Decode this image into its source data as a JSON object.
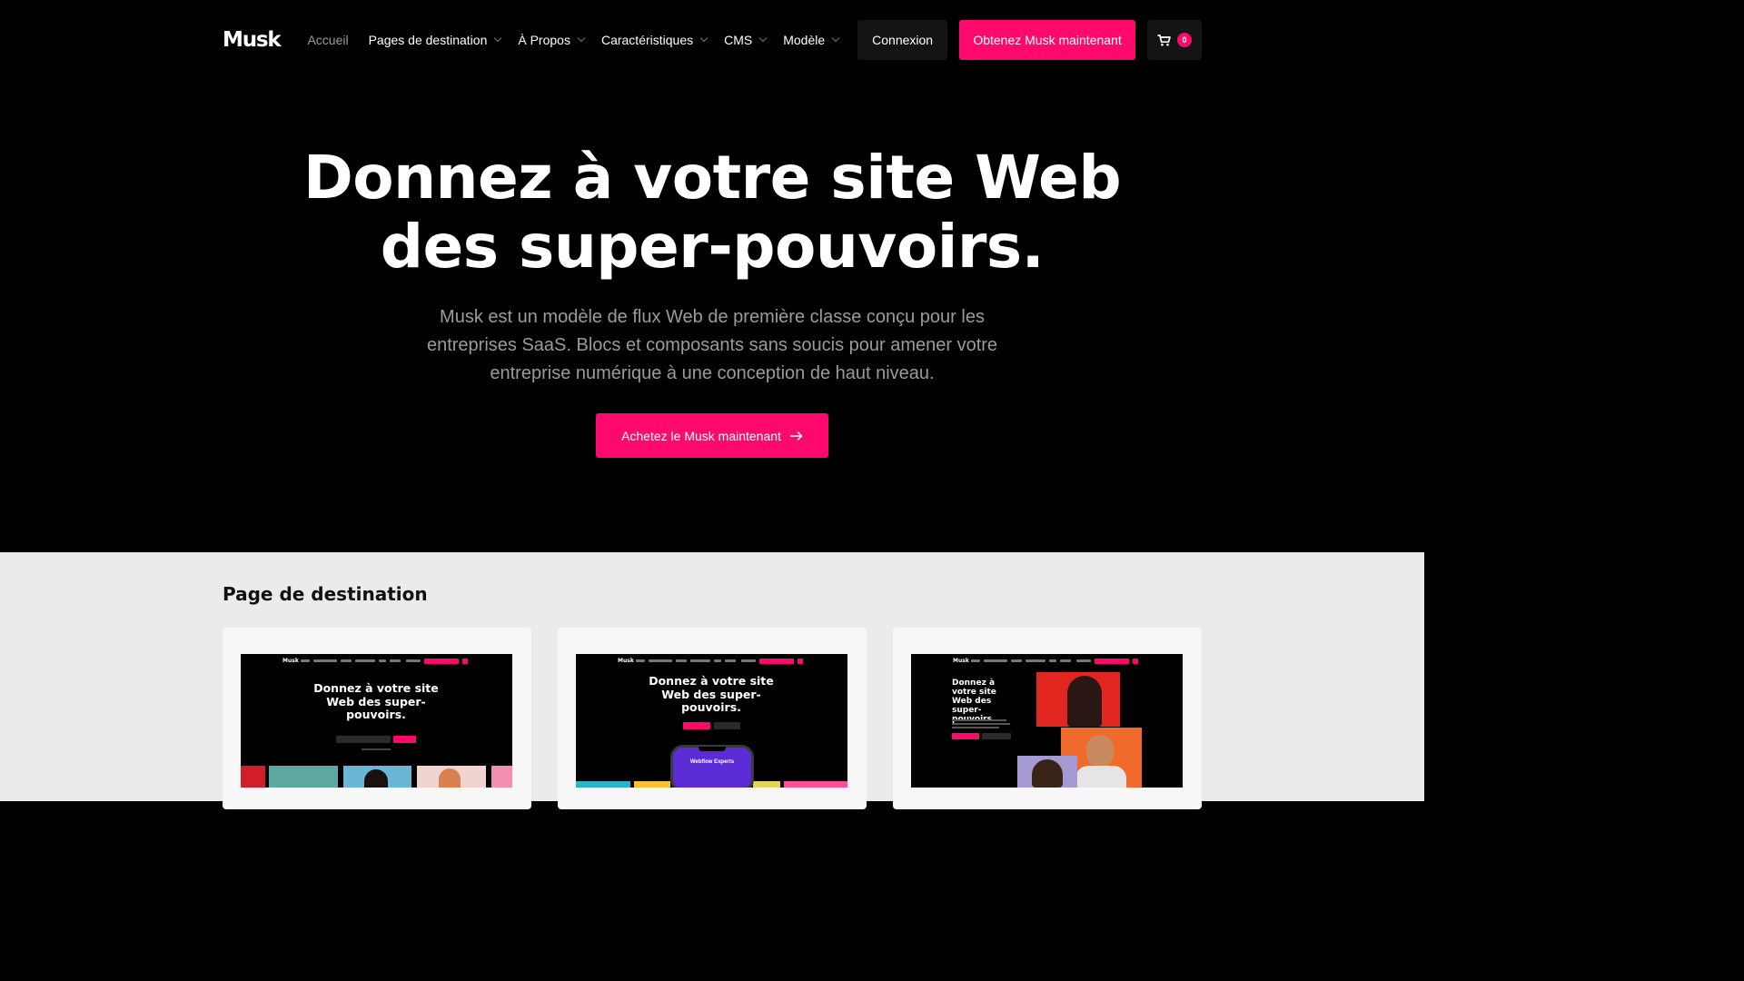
{
  "brand": {
    "logo": "Musk",
    "accent": "#ff0a6c"
  },
  "nav": {
    "items": [
      {
        "label": "Accueil",
        "dropdown": false
      },
      {
        "label": "Pages de destination",
        "dropdown": true
      },
      {
        "label": "À Propos",
        "dropdown": true
      },
      {
        "label": "Caractéristiques",
        "dropdown": true
      },
      {
        "label": "CMS",
        "dropdown": true
      },
      {
        "label": "Modèle",
        "dropdown": true
      }
    ],
    "login_label": "Connexion",
    "cta_label": "Obtenez Musk maintenant",
    "cart_icon": "cart-icon",
    "cart_count": "0"
  },
  "hero": {
    "title_line1": "Donnez à votre site Web",
    "title_line2": "des super-pouvoirs.",
    "subtitle_line1": "Musk est un modèle de flux Web de première classe conçu pour les",
    "subtitle_line2": "entreprises SaaS. Blocs et composants sans soucis pour amener votre",
    "subtitle_line3": "entreprise numérique à une conception de haut niveau.",
    "button_label": "Achetez le Musk maintenant",
    "button_icon": "arrow-right-icon"
  },
  "landing": {
    "title": "Page de destination",
    "cards": [
      {
        "thumb_logo": "Musk",
        "thumb_title": "Donnez à votre site Web des super-pouvoirs."
      },
      {
        "thumb_logo": "Musk",
        "thumb_title": "Donnez à votre site Web des super-pouvoirs.",
        "phone_label": "Webflow Experts"
      },
      {
        "thumb_logo": "Musk",
        "thumb_title": "Donnez à votre site Web des super-pouvoirs."
      }
    ]
  }
}
